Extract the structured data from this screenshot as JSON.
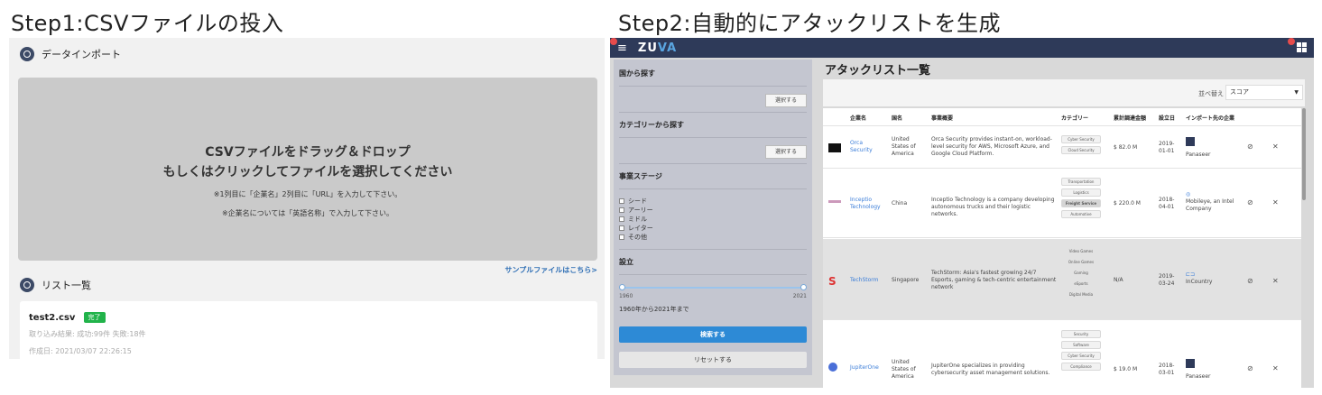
{
  "step1_title": "Step1:CSVファイルの投入",
  "step2_title": "Step2:自動的にアタックリストを生成",
  "left": {
    "import_heading": "データインポート",
    "dropzone": {
      "line1": "CSVファイルをドラッグ＆ドロップ",
      "line2": "もしくはクリックしてファイルを選択してください",
      "note1": "※1列目に「企業名」2列目に「URL」を入力して下さい。",
      "note2": "※企業名については「英語名称」で入力して下さい。"
    },
    "sample_link": "サンプルファイルはこちら>",
    "list_heading": "リスト一覧",
    "file": {
      "name": "test2.csv",
      "badge": "完了",
      "result": "取り込み結果: 成功:99件 失敗:18件",
      "created": "作成日: 2021/03/07 22:26:15"
    }
  },
  "right": {
    "logo_a": "ZU",
    "logo_b": "VA",
    "sidebar": {
      "country_label": "国から探す",
      "country_select": "選択する",
      "category_label": "カテゴリーから探す",
      "category_select": "選択する",
      "stage_label": "事業ステージ",
      "stages": [
        "シード",
        "アーリー",
        "ミドル",
        "レイター",
        "その他"
      ],
      "founded_label": "設立",
      "slider_min": "1960",
      "slider_max": "2021",
      "slider_range": "1960年から2021年まで",
      "search_button": "検索する",
      "reset_button": "リセットする"
    },
    "content_title": "アタックリスト一覧",
    "sort_label": "並べ替え",
    "sort_value": "スコア",
    "headers": {
      "company": "企業名",
      "country": "国名",
      "summary": "事業概要",
      "category": "カテゴリー",
      "funding": "累計調達金額",
      "founded": "設立日",
      "importer": "インポート先の企業"
    },
    "rows": [
      {
        "name": "Orca Security",
        "country": "United States of America",
        "summary": "Orca Security provides instant-on, workload-level security for AWS, Microsoft Azure, and Google Cloud Platform.",
        "tags": [
          "Cyber Security",
          "Cloud Security"
        ],
        "funding": "$ 82.0 M",
        "founded": "2019-01-01",
        "importer": "Panaseer"
      },
      {
        "name": "Inceptio Technology",
        "country": "China",
        "summary": "Inceptio Technology is a company developing autonomous trucks and their logistic networks.",
        "tags": [
          "Transportation",
          "Logistics",
          "Freight Service",
          "Automotive"
        ],
        "funding": "$ 220.0 M",
        "founded": "2018-04-01",
        "importer": "Mobileye, an Intel Company"
      },
      {
        "name": "TechStorm",
        "country": "Singapore",
        "summary": "TechStorm: Asia's fastest growing 24/7 Esports, gaming & tech-centric entertainment network",
        "tags": [
          "Video Games",
          "Online Games",
          "Gaming",
          "eSports",
          "Digital Media"
        ],
        "funding": "N/A",
        "founded": "2019-03-24",
        "importer": "InCountry"
      },
      {
        "name": "JupiterOne",
        "country": "United States of America",
        "summary": "JupiterOne specializes in providing cybersecurity asset management solutions.",
        "tags": [
          "Security",
          "Software",
          "Cyber Security",
          "Compliance"
        ],
        "funding": "$ 19.0 M",
        "founded": "2018-03-01",
        "importer": "Panaseer"
      }
    ]
  }
}
